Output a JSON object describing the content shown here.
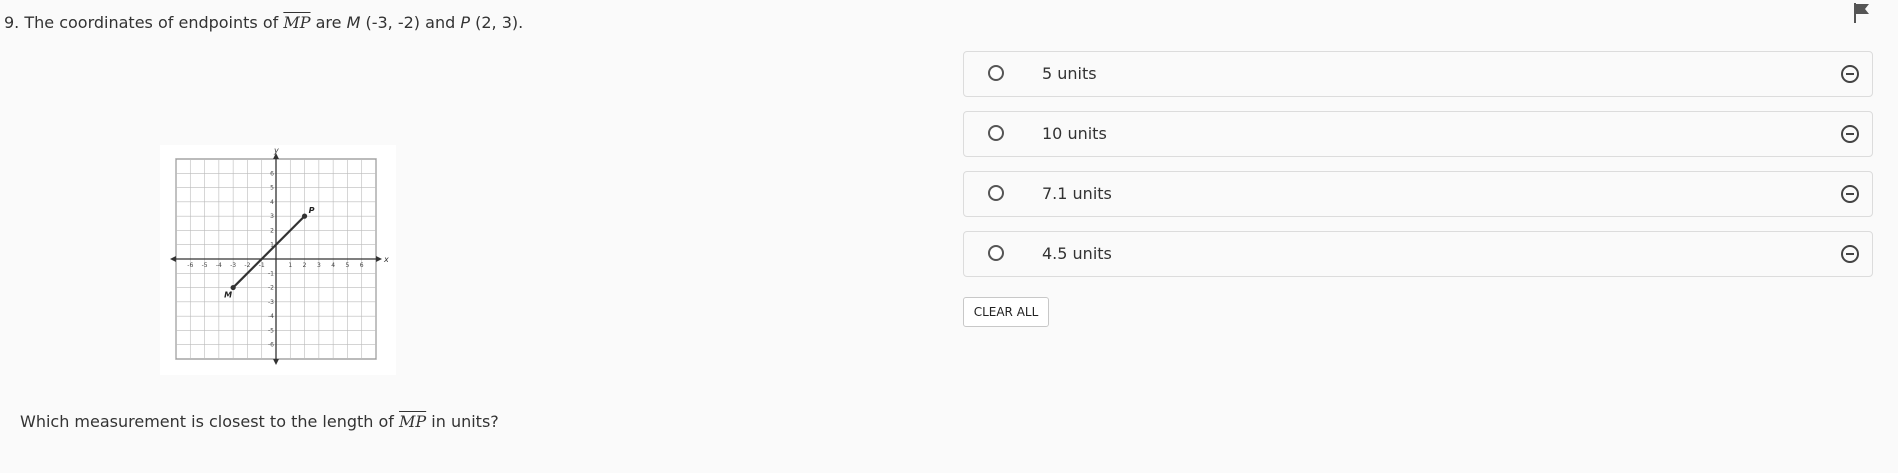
{
  "question": {
    "number": "9.",
    "text_before": "The coordinates of endpoints of",
    "segment": "MP",
    "text_mid": "are",
    "point1_label": "M",
    "point1_coords": "(-3, -2)",
    "and": "and",
    "point2_label": "P",
    "point2_coords": "(2, 3)."
  },
  "prompt": {
    "before": "Which measurement is closest to the length of",
    "segment": "MP",
    "after": "in units?"
  },
  "choices": [
    {
      "label": "5 units"
    },
    {
      "label": "10 units"
    },
    {
      "label": "7.1 units"
    },
    {
      "label": "4.5 units"
    }
  ],
  "clear_all_label": "CLEAR ALL",
  "icons": {
    "flag": "flag-icon",
    "radio": "radio-icon",
    "eliminate": "eliminate-icon"
  },
  "colors": {
    "segment": "#333333",
    "grid": "#bbbbbb",
    "axes": "#333333"
  },
  "graph": {
    "x_axis_label": "x",
    "y_axis_label": "y",
    "x_range": [
      -6,
      6
    ],
    "y_range": [
      -6,
      6
    ],
    "x_ticks": [
      "-6",
      "-5",
      "-4",
      "-3",
      "-2",
      "-1",
      "1",
      "2",
      "3",
      "4",
      "5",
      "6"
    ],
    "y_ticks": [
      "6",
      "5",
      "4",
      "3",
      "2",
      "1",
      "-1",
      "-2",
      "-3",
      "-4",
      "-5",
      "-6"
    ],
    "points": [
      {
        "label": "M",
        "x": -3,
        "y": -2
      },
      {
        "label": "P",
        "x": 2,
        "y": 3
      }
    ]
  }
}
